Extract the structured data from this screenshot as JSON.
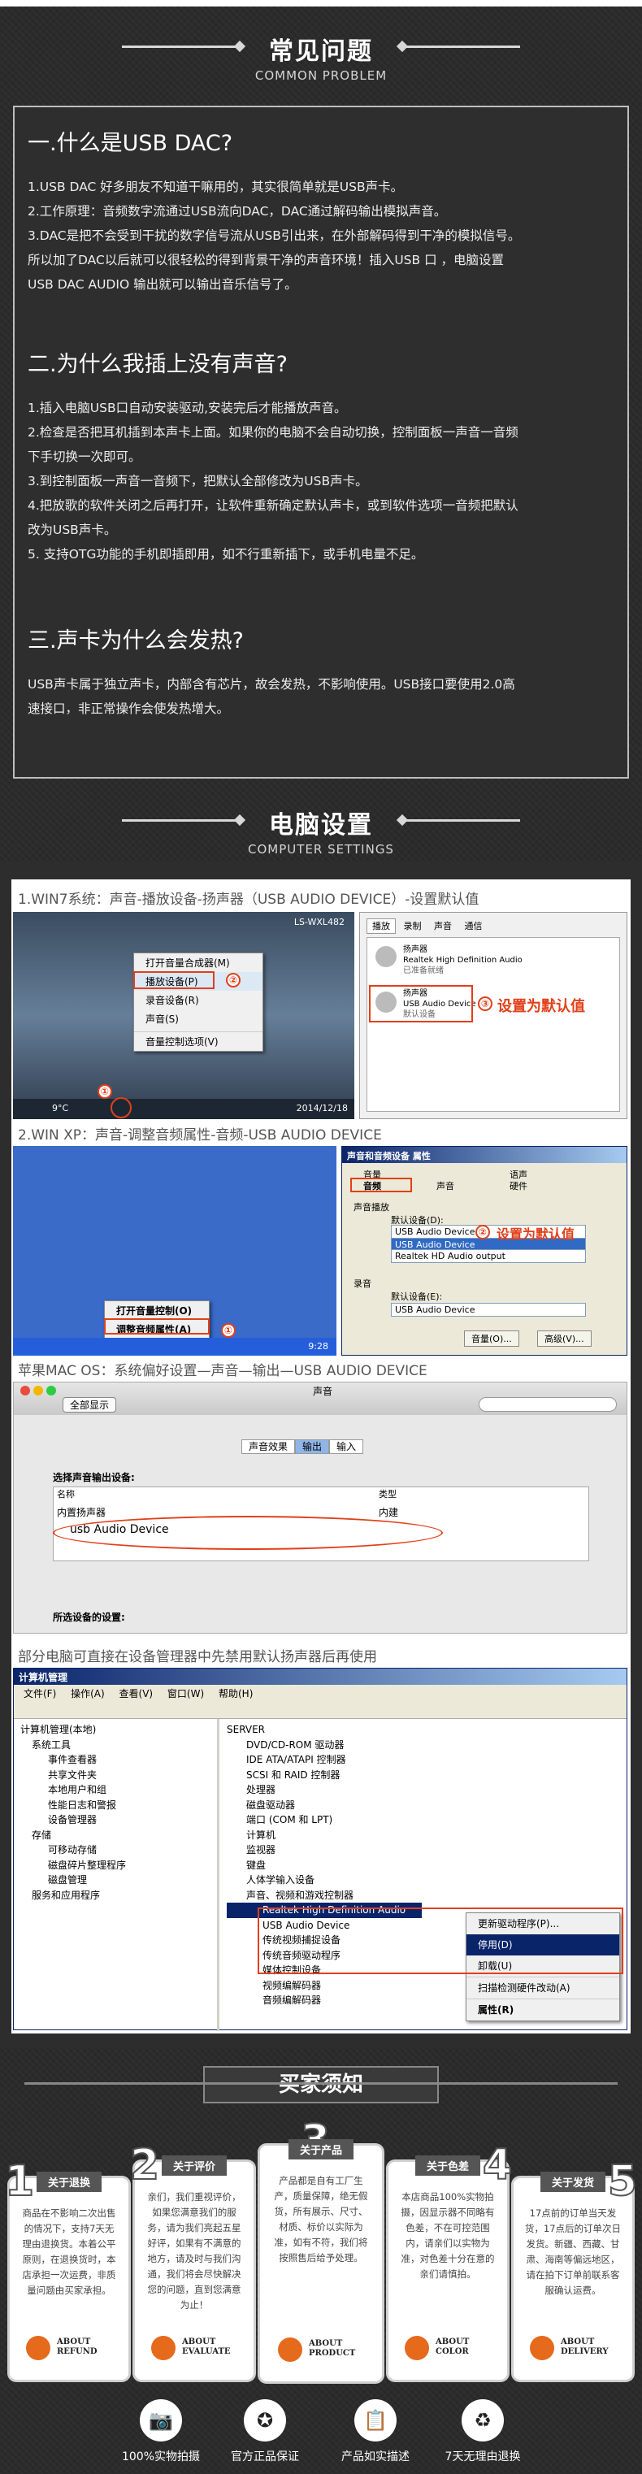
{
  "faq": {
    "title_cn": "常见问题",
    "title_en": "COMMON PROBLEM",
    "q1": {
      "title": "一.什么是USB DAC?",
      "lines": [
        "1.USB DAC 好多朋友不知道干嘛用的，其实很简单就是USB声卡。",
        "2.工作原理：音频数字流通过USB流向DAC，DAC通过解码输出模拟声音。",
        "3.DAC是把不会受到干扰的数字信号流从USB引出来，在外部解码得到干净的模拟信号。",
        "所以加了DAC以后就可以很轻松的得到背景干净的声音环境！插入USB 口 ，电脑设置",
        "USB DAC AUDIO  输出就可以输出音乐信号了。"
      ]
    },
    "q2": {
      "title": "二.为什么我插上没有声音?",
      "lines": [
        "1.插入电脑USB口自动安装驱动,安装完后才能播放声音。",
        "2.检查是否把耳机插到本声卡上面。如果你的电脑不会自动切换，控制面板一声音一音频",
        "下手切换一次即可。",
        "3.到控制面板一声音一音频下，把默认全部修改为USB声卡。",
        "4.把放歌的软件关闭之后再打开，让软件重新确定默认声卡，或到软件选项一音频把默认",
        "改为USB声卡。",
        "5. 支持OTG功能的手机即插即用，如不行重新插下，或手机电量不足。"
      ]
    },
    "q3": {
      "title": "三.声卡为什么会发热?",
      "lines": [
        "USB声卡属于独立声卡，内部含有芯片，故会发热，不影响使用。USB接口要使用2.0高",
        "速接口，非正常操作会使发热增大。"
      ]
    }
  },
  "settings": {
    "title_cn": "电脑设置",
    "title_en": "COMPUTER SETTINGS",
    "win7": {
      "caption": "1.WIN7系统：声音-播放设备-扬声器（USB AUDIO DEVICE）-设置默认值",
      "pc_name": "LS-WXL482",
      "menu": [
        "打开音量合成器(M)",
        "播放设备(P)",
        "录音设备(R)",
        "声音(S)",
        "音量控制选项(V)"
      ],
      "temp": "9°C",
      "date": "2014/12/18",
      "tabs": [
        "播放",
        "录制",
        "声音",
        "通信"
      ],
      "dev1_name": "扬声器",
      "dev1_desc": "Realtek High Definition Audio",
      "dev1_state": "已准备就绪",
      "dev2_name": "扬声器",
      "dev2_desc": "USB Audio Device",
      "dev2_state": "默认设备",
      "set_default": "设置为默认值",
      "mark1": "①",
      "mark2": "②",
      "mark3": "③"
    },
    "xp": {
      "caption": "2.WIN XP：声音-调整音频属性-音频-USB AUDIO DEVICE",
      "dlg_title": "声音和音频设备 属性",
      "tabs": [
        "音量",
        "声音",
        "音频",
        "语声",
        "硬件"
      ],
      "playback": "声音播放",
      "default_device": "默认设备(D):",
      "dd_value": "USB Audio Device",
      "dd_opt1": "USB Audio Device",
      "dd_opt2": "Realtek HD Audio output",
      "record": "录音",
      "rec_default": "默认设备(E):",
      "rec_value": "USB Audio Device",
      "vol_btn": "音量(O)...",
      "adv_btn": "高级(V)...",
      "set_default": "设置为默认值",
      "menu": [
        "打开音量控制(O)",
        "调整音频属性(A)"
      ],
      "time": "9:28",
      "mark1": "①",
      "mark2": "②"
    },
    "mac": {
      "caption": "苹果MAC OS：系统偏好设置—声音—输出—USB AUDIO DEVICE",
      "window_title": "声音",
      "show_all": "全部显示",
      "tabs": [
        "声音效果",
        "输出",
        "输入"
      ],
      "select_label": "选择声音输出设备:",
      "col_name": "名称",
      "col_type": "类型",
      "row1_name": "内置扬声器",
      "row1_type": "内建",
      "row2_name": "usb Audio Device",
      "selected_label": "所选设备的设置:"
    },
    "devmgr": {
      "caption": "部分电脑可直接在设备管理器中先禁用默认扬声器后再使用",
      "window_title": "计算机管理",
      "menus": [
        "文件(F)",
        "操作(A)",
        "查看(V)",
        "窗口(W)",
        "帮助(H)"
      ],
      "left_tree": [
        "计算机管理(本地)",
        "系统工具",
        "事件查看器",
        "共享文件夹",
        "本地用户和组",
        "性能日志和警报",
        "设备管理器",
        "存储",
        "可移动存储",
        "磁盘碎片整理程序",
        "磁盘管理",
        "服务和应用程序"
      ],
      "right_tree": [
        "SERVER",
        "DVD/CD-ROM 驱动器",
        "IDE ATA/ATAPI 控制器",
        "SCSI 和 RAID 控制器",
        "处理器",
        "磁盘驱动器",
        "端口 (COM 和 LPT)",
        "计算机",
        "监视器",
        "键盘",
        "人体学输入设备",
        "声音、视频和游戏控制器",
        "Realtek High Definition Audio",
        "USB Audio Device",
        "传统视频捕捉设备",
        "传统音频驱动程序",
        "媒体控制设备",
        "视频编解码器",
        "音频编解码器"
      ],
      "ctx_menu": [
        "更新驱动程序(P)...",
        "停用(D)",
        "卸载(U)",
        "扫描检测硬件改动(A)",
        "属性(R)"
      ]
    }
  },
  "notes": {
    "title": "买家须知",
    "cards": [
      {
        "num": "1",
        "title": "关于退换",
        "body": "商品在不影响二次出售的情况下，支持7天无理由退换货。本着公平原则，在退换货时，本店承担一次运费，非质量问题由买家承担。",
        "about1": "ABOUT",
        "about2": "REFUND"
      },
      {
        "num": "2",
        "title": "关于评价",
        "body": "亲们，我们重视评价，如果您满意我们的服务，请为我们亮起五星好评，如果有不满意的地方，请及时与我们沟通，我们将会尽快解决您的问题，直到您满意为止！",
        "about1": "ABOUT",
        "about2": "EVALUATE"
      },
      {
        "num": "3",
        "title": "关于产品",
        "body": "产品都是自有工厂生产，质量保障，绝无假货，所有展示、尺寸、材质、标价以实际为准，如有不符，我们将按照售后给予处理。",
        "about1": "ABOUT",
        "about2": "PRODUCT"
      },
      {
        "num": "4",
        "title": "关于色差",
        "body": "本店商品100%实物拍摄，因显示器不同略有色差，不在可控范围内，请亲们以实物为准，对色差十分在意的亲们请慎拍。",
        "about1": "ABOUT",
        "about2": "COLOR"
      },
      {
        "num": "5",
        "title": "关于发货",
        "body": "17点前的订单当天发货，17点后的订单次日发货。新疆、西藏、甘肃、海南等偏远地区，请在拍下订单前联系客服确认运费。",
        "about1": "ABOUT",
        "about2": "DELIVERY"
      }
    ],
    "bottom": [
      {
        "icon": "camera-icon",
        "glyph": "📷",
        "label": "100%实物拍摄"
      },
      {
        "icon": "certificate-icon",
        "glyph": "✪",
        "label": "官方正品保证"
      },
      {
        "icon": "clipboard-icon",
        "glyph": "📋",
        "label": "产品如实描述"
      },
      {
        "icon": "recycle-icon",
        "glyph": "♻",
        "label": "7天无理由退换"
      }
    ]
  }
}
